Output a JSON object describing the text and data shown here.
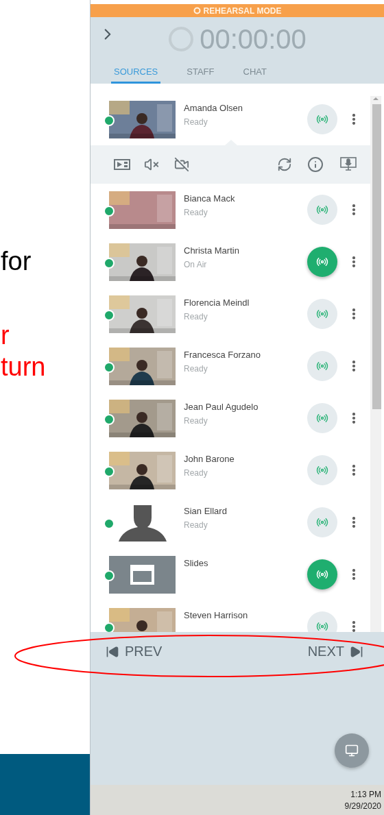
{
  "slide": {
    "paragraphs": [
      {
        "color": "#000000",
        "lines": [
          "for"
        ]
      },
      {
        "color": "#ff0000",
        "lines": [
          "r",
          "turn"
        ]
      }
    ]
  },
  "annotation": {
    "kind": "ellipse"
  },
  "banner": {
    "text": "REHEARSAL MODE"
  },
  "timer": "00:00:00",
  "tabs": [
    {
      "label": "SOURCES",
      "selected": true
    },
    {
      "label": "STAFF",
      "selected": false
    },
    {
      "label": "CHAT",
      "selected": false
    }
  ],
  "sources": [
    {
      "name": "Amanda Olsen",
      "status": "Ready",
      "on_air": false,
      "expanded": true,
      "kind": "picture"
    },
    {
      "name": "Bianca Mack",
      "status": "Ready",
      "on_air": false,
      "expanded": false,
      "kind": "picture"
    },
    {
      "name": "Christa Martin",
      "status": "On Air",
      "on_air": true,
      "expanded": false,
      "kind": "picture"
    },
    {
      "name": "Florencia Meindl",
      "status": "Ready",
      "on_air": false,
      "expanded": false,
      "kind": "picture"
    },
    {
      "name": "Francesca Forzano",
      "status": "Ready",
      "on_air": false,
      "expanded": false,
      "kind": "picture"
    },
    {
      "name": "Jean Paul Agudelo",
      "status": "Ready",
      "on_air": false,
      "expanded": false,
      "kind": "picture"
    },
    {
      "name": "John Barone",
      "status": "Ready",
      "on_air": false,
      "expanded": false,
      "kind": "picture"
    },
    {
      "name": "Sian Ellard",
      "status": "Ready",
      "on_air": false,
      "expanded": false,
      "kind": "silhouette"
    },
    {
      "name": "Slides",
      "on_air": true,
      "expanded": false,
      "kind": "slides"
    },
    {
      "name": "Steven Harrison",
      "on_air": false,
      "expanded": false,
      "kind": "picture"
    }
  ],
  "pager": {
    "prev": "PREV",
    "next": "NEXT"
  },
  "taskbar": {
    "time": "1:13 PM",
    "date": "9/29/2020"
  }
}
